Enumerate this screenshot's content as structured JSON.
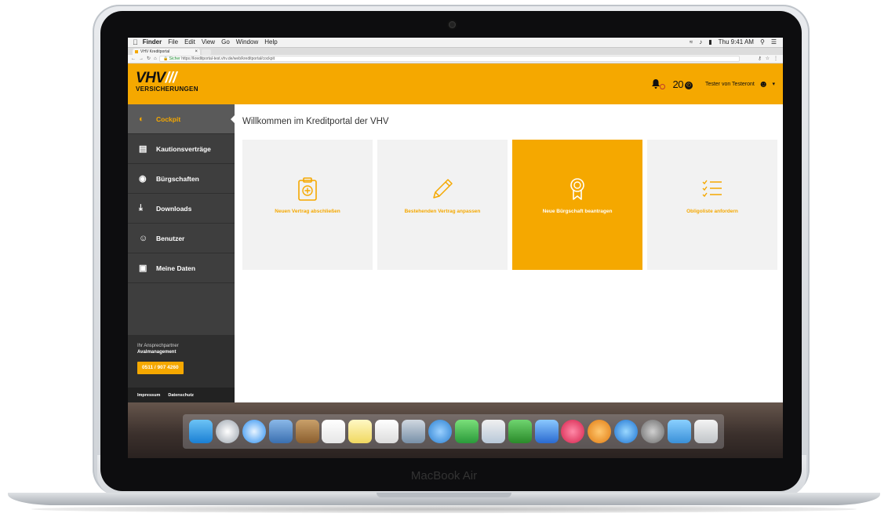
{
  "device": {
    "label": "MacBook Air"
  },
  "mac_menubar": {
    "items": [
      "Finder",
      "File",
      "Edit",
      "View",
      "Go",
      "Window",
      "Help"
    ],
    "clock": "Thu 9:41 AM"
  },
  "browser": {
    "tab_title": "VHV Kreditportal",
    "secure_label": "Sicher",
    "url": "https://kreditportal-test.vhv.de/web/kreditportal/cockpit"
  },
  "header": {
    "logo_top": "VHV",
    "logo_slashes": "///",
    "logo_bottom": "VERSICHERUNGEN",
    "count": "20",
    "user_name": "Tester von Testeront"
  },
  "sidebar": {
    "items": [
      {
        "label": "Cockpit",
        "icon": "gauge-icon",
        "active": true
      },
      {
        "label": "Kautionsverträge",
        "icon": "document-icon",
        "active": false
      },
      {
        "label": "Bürgschaften",
        "icon": "award-icon",
        "active": false
      },
      {
        "label": "Downloads",
        "icon": "download-icon",
        "active": false
      },
      {
        "label": "Benutzer",
        "icon": "users-icon",
        "active": false
      },
      {
        "label": "Meine Daten",
        "icon": "id-card-icon",
        "active": false
      }
    ],
    "contact_label": "Ihr Ansprechpartner",
    "contact_name": "Avalmanagement",
    "phone": "0511 / 907 4260",
    "footer_links": [
      "Impressum",
      "Datenschutz"
    ]
  },
  "main": {
    "title": "Willkommen im Kreditportal der VHV",
    "tiles": [
      {
        "label": "Neuen Vertrag abschließen",
        "icon": "clipboard-plus-icon",
        "active": false
      },
      {
        "label": "Bestehenden Vertrag anpassen",
        "icon": "pencil-icon",
        "active": false
      },
      {
        "label": "Neue Bürgschaft beantragen",
        "icon": "award-icon",
        "active": true
      },
      {
        "label": "Obligoliste anfordern",
        "icon": "checklist-icon",
        "active": false
      }
    ]
  },
  "colors": {
    "accent": "#f5a800",
    "sidebar": "#3e3e3e",
    "tile": "#f2f2f2"
  }
}
